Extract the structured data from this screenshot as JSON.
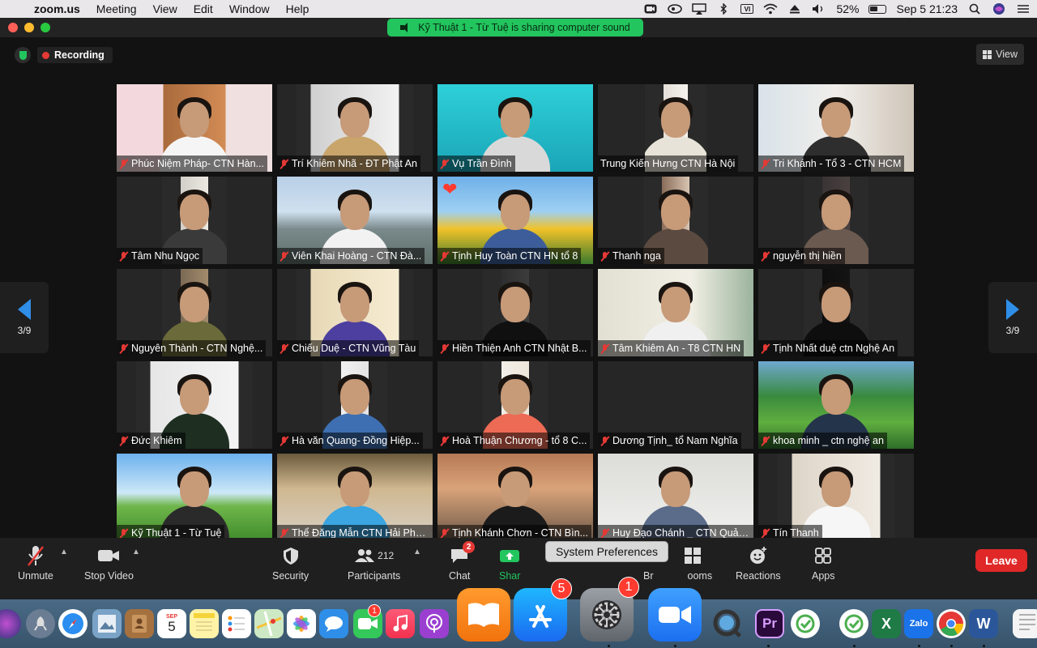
{
  "menubar": {
    "app": "zoom.us",
    "menus": [
      "Meeting",
      "View",
      "Edit",
      "Window",
      "Help"
    ],
    "battery": "52%",
    "datetime": "Sep 5  21:23"
  },
  "banner": {
    "text": "Kỹ Thuật 1  - Từ Tuệ is sharing computer sound"
  },
  "meeting": {
    "recording_label": "Recording",
    "view_label": "View",
    "page_left": "3/9",
    "page_right": "3/9"
  },
  "participants": [
    "Phúc Niệm Pháp- CTN Hàn...",
    "Trí Khiêm Nhã - ĐT Phật An",
    "Vụ Trần Đình",
    "Trung Kiến Hưng CTN Hà Nội",
    "Tri Khánh - Tổ 3 - CTN HCM",
    "Tâm Nhu Ngọc",
    "Viên Khai Hoàng - CTN Đà...",
    "Tịnh Huy Toàn CTN HN tổ 8",
    "Thanh nga",
    "nguyễn thị hiền",
    "Nguyên Thành - CTN Nghệ...",
    "Chiếu Duệ - CTN Vũng Tàu",
    "Hiền Thiện Anh CTN Nhật B...",
    "Tâm Khiêm An - T8 CTN HN",
    "Tịnh Nhất duệ ctn Nghệ An",
    "Đức Khiêm",
    "Hà văn Quang- Đồng Hiệp...",
    "Hoà Thuận Chương - tổ 8 C...",
    "Dương Tịnh_ tổ Nam Nghĩa",
    "khoa minh _ ctn nghệ an",
    "Kỹ Thuật 1  - Từ Tuệ",
    "Thể Đăng Mẫn CTN Hải Phò...",
    "Tịnh Khánh Chơn - CTN Bìn...",
    "Huy Đạo Chánh _ CTN Quản...",
    "Tín Thanh"
  ],
  "toolbar": {
    "unmute": "Unmute",
    "stop_video": "Stop Video",
    "security": "Security",
    "participants_count": "212",
    "participants": "Participants",
    "chat": "Chat",
    "chat_badge": "2",
    "share_partial": "Shar",
    "breakout_partial": "Br",
    "rooms_partial": "ooms",
    "reactions": "Reactions",
    "apps": "Apps",
    "leave": "Leave"
  },
  "tooltip": {
    "text": "System Preferences"
  },
  "dock": {
    "calendar_month": "SEP",
    "calendar_day": "5",
    "facetime_badge": "1",
    "appstore_badge": "5",
    "sysprefs_badge": "1",
    "zalo_label": "Zalo",
    "pr_label": "Pr",
    "x_label": "X",
    "w_label": "W"
  }
}
